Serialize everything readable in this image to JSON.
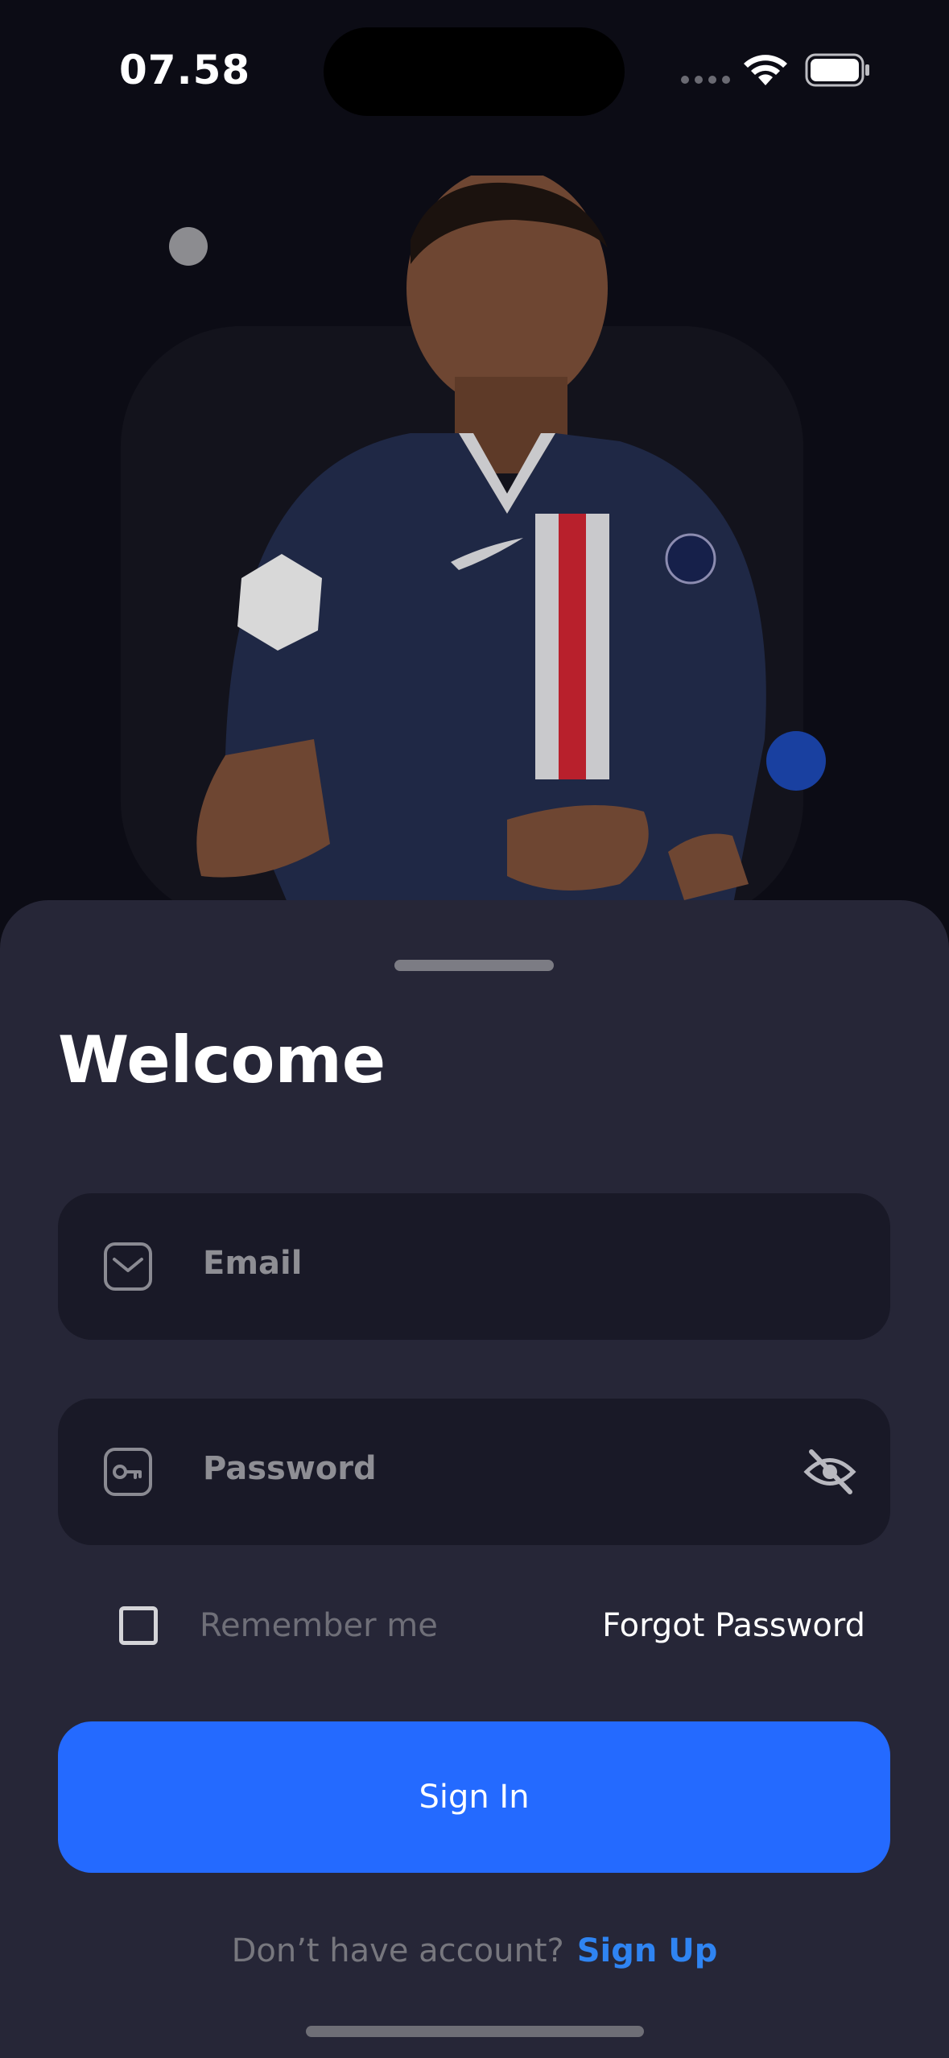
{
  "status_bar": {
    "time": "07.58"
  },
  "login": {
    "title": "Welcome",
    "email_placeholder": "Email",
    "password_placeholder": "Password",
    "remember_label": "Remember me",
    "forgot_label": "Forgot Password",
    "signin_label": "Sign In",
    "footer_question": "Don’t have account?",
    "signup_label": "Sign Up"
  },
  "colors": {
    "background": "#0c0c15",
    "sheet": "#262637",
    "field": "#191927",
    "primary": "#246aff",
    "link": "#2f84f2"
  },
  "icons": {
    "email": "mail-icon",
    "password": "key-icon",
    "visibility": "eye-off-icon"
  }
}
